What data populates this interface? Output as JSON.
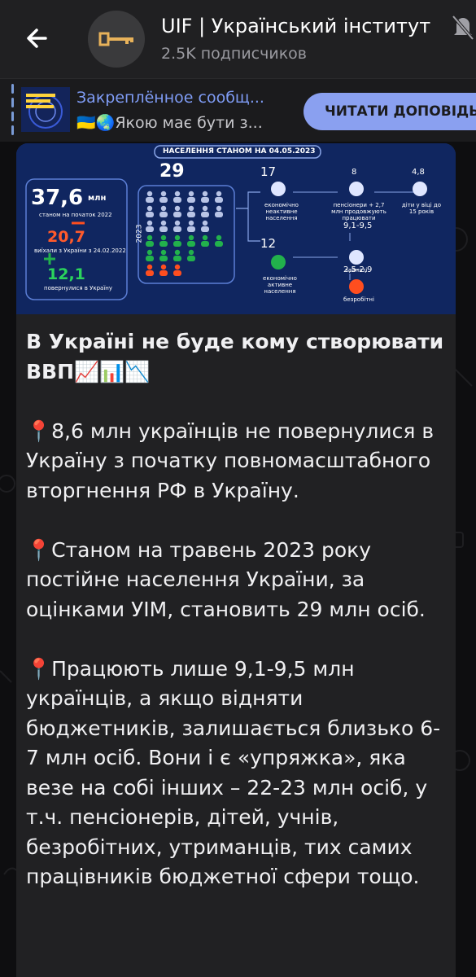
{
  "header": {
    "title": "UIF | Український інститут",
    "subtitle": "2.5K подписчиков"
  },
  "pinned": {
    "title": "Закреплённое сообщ...",
    "text": "🇺🇦🌏Якою має бути з...",
    "button": "ЧИТАТИ ДОПОВІДЬ"
  },
  "infographic": {
    "banner": "НАСЕЛЕННЯ СТАНОМ НА 04.05.2023",
    "big_total": "37,6",
    "unit": "млн",
    "big_total_caption": "станом на початок 2022",
    "left_value": "20,7",
    "left_caption": "виїхали з України з 24.02.2022",
    "returned_value": "12,1",
    "returned_caption": "повернулися в Україну",
    "current": "29",
    "year": "2023",
    "inactive_value": "17",
    "inactive_caption": "економічно неактивне населення",
    "pension_value": "8",
    "pension_caption": "пенсіонери + 2,7 млн продовжують працювати",
    "kids_value": "4,8",
    "kids_caption": "діти у віці до 15 років",
    "active_value": "12",
    "active_caption": "економічно активне населення",
    "employed_value": "9,1-9,5",
    "employed_caption": "зайняті",
    "unemployed_value": "2,5-2,9",
    "unemployed_caption": "безробітні"
  },
  "message": {
    "headline": "В Україні не буде кому створювати ВВП📈📊📉",
    "p1": "📍8,6 млн українців не повернулися в Україну з початку повномасштабного вторгнення РФ в Україну.",
    "p2": "📍Станом на травень 2023 року постійне населення України, за оцінками УІМ, становить 29 млн осіб.",
    "p3": "📍Працюють лише 9,1-9,5 млн українців, а якщо відняти бюджетників, залишається близько 6-7 млн осіб. Вони і є «упряжка», яка везе на собі інших – 22-23 млн осіб, у т.ч. пенсіонерів, дітей, учнів, безробітних, утриманців, тих самих працівників бюджетної сфери тощо."
  },
  "colors": {
    "header_bg": "#202022",
    "accent": "#8aa0f0",
    "bubble_bg": "#212123",
    "infographic_bg": "#102660",
    "orange": "#ff4e1f",
    "green": "#22b14c"
  }
}
